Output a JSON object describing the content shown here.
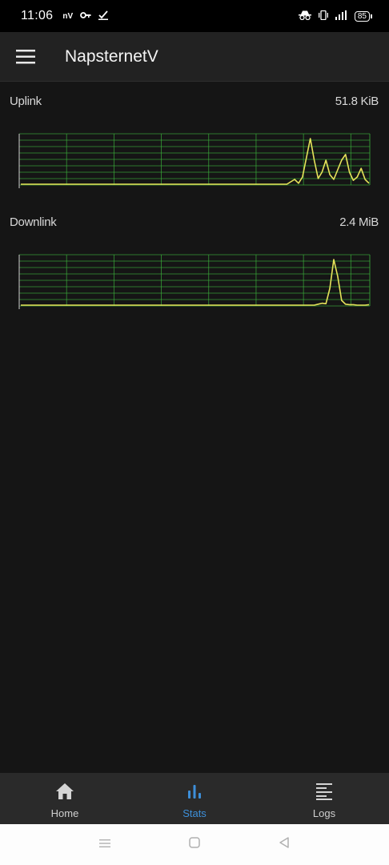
{
  "status_bar": {
    "time": "11:06",
    "left_icons": [
      "nv-icon",
      "key-icon",
      "check-icon"
    ],
    "nv_text": "nV",
    "battery": "85",
    "right_icons": [
      "incognito-icon",
      "vibrate-icon",
      "signal-icon",
      "battery-icon"
    ]
  },
  "app_bar": {
    "title": "NapsternetV",
    "menu_icon": "hamburger-menu-icon"
  },
  "stats": {
    "uplink": {
      "label": "Uplink",
      "value": "51.8 KiB",
      "line_color": "#e6e35a",
      "grid_color": "#3bb03b",
      "series": [
        0,
        0,
        0,
        0,
        0,
        0,
        0,
        0,
        0,
        0,
        0,
        0,
        0,
        0,
        0,
        0,
        0,
        0,
        0,
        0,
        0,
        0,
        0,
        0,
        0,
        0,
        0,
        0,
        0,
        0,
        0,
        0,
        0,
        0,
        0,
        0,
        0,
        0,
        0,
        0,
        0,
        0,
        0,
        0,
        0,
        0,
        0,
        0,
        0,
        0,
        0,
        0,
        0,
        0,
        0,
        0,
        0,
        0,
        0,
        0,
        0,
        0,
        0,
        0,
        0,
        0,
        0,
        0,
        0,
        0.05,
        0.1,
        0.02,
        0.15,
        0.55,
        0.95,
        0.5,
        0.12,
        0.25,
        0.5,
        0.2,
        0.1,
        0.3,
        0.5,
        0.62,
        0.25,
        0.08,
        0.15,
        0.33,
        0.1,
        0.02
      ]
    },
    "downlink": {
      "label": "Downlink",
      "value": "2.4 MiB",
      "line_color": "#e6e35a",
      "grid_color": "#3bb03b",
      "series": [
        0,
        0,
        0,
        0,
        0,
        0,
        0,
        0,
        0,
        0,
        0,
        0,
        0,
        0,
        0,
        0,
        0,
        0,
        0,
        0,
        0,
        0,
        0,
        0,
        0,
        0,
        0,
        0,
        0,
        0,
        0,
        0,
        0,
        0,
        0,
        0,
        0,
        0,
        0,
        0,
        0,
        0,
        0,
        0,
        0,
        0,
        0,
        0,
        0,
        0,
        0,
        0,
        0,
        0,
        0,
        0,
        0,
        0,
        0,
        0,
        0,
        0,
        0,
        0,
        0,
        0,
        0,
        0,
        0,
        0,
        0,
        0,
        0,
        0,
        0,
        0,
        0.02,
        0.04,
        0.03,
        0.35,
        0.95,
        0.6,
        0.1,
        0.02,
        0.01,
        0.01,
        0,
        0,
        0,
        0.01
      ]
    }
  },
  "bottom_nav": {
    "items": [
      {
        "label": "Home",
        "icon": "home-icon",
        "active": false
      },
      {
        "label": "Stats",
        "icon": "bar-chart-icon",
        "active": true
      },
      {
        "label": "Logs",
        "icon": "logs-icon",
        "active": false
      }
    ],
    "active_color": "#3d8fd9"
  },
  "system_nav": {
    "icons": [
      "recents-icon",
      "home-square-icon",
      "back-triangle-icon"
    ]
  }
}
